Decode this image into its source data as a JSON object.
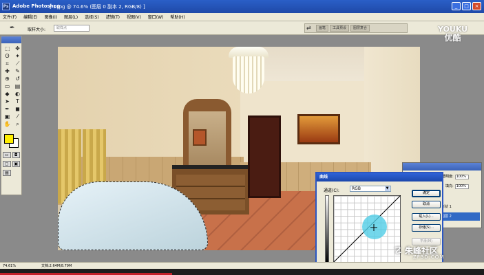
{
  "title_bar": {
    "app_title": "Adobe Photoshop",
    "document_title": "[ 1.jpg @ 74.6% (图层 0 副本 2, RGB/8) ]",
    "ps_icon": "Ps",
    "minimize": "_",
    "maximize": "□",
    "close": "×"
  },
  "menu": {
    "items": [
      "文件(F)",
      "编辑(E)",
      "图像(I)",
      "图层(L)",
      "选择(S)",
      "滤镜(T)",
      "视图(V)",
      "窗口(W)",
      "帮助(H)"
    ]
  },
  "options_bar": {
    "tool_icon": "eyedropper-icon",
    "tool_glyph": "✒",
    "sample_size_label": "取样大小:",
    "sample_size_value": "取样点",
    "palette_well_icon_glyph": "⇄",
    "palette_well_tabs": [
      "画笔",
      "工具预设",
      "图层复合"
    ]
  },
  "watermark_top": {
    "line1": "YOUKU",
    "line2": "优酷"
  },
  "watermark_bottom": {
    "main": "朱峰社区",
    "sub": "ZF3D.COM",
    "icon_glyph": "☡"
  },
  "status_bar": {
    "zoom": "74.61%",
    "doc_info": "文档:2.64M/8.79M",
    "progress": 0
  },
  "layers_panel": {
    "opacity_label": "不透明度:",
    "opacity_value": "100%",
    "fill_label": "填充:",
    "fill_value": "100%",
    "layers": [
      "形状 1",
      "图层 2"
    ],
    "selected_index": 1
  },
  "curves_dialog": {
    "title": "曲线",
    "channel_label": "通道(C):",
    "channel_value": "RGB",
    "buttons": {
      "ok": "确定",
      "cancel": "取消",
      "load": "载入(L)...",
      "save": "存储(S)...",
      "smooth": "平滑(M)"
    }
  },
  "colors": {
    "foreground": "#ffee00",
    "background": "#ffffff",
    "title_bar": "#2a5fc7",
    "highlight": "#50cde6"
  },
  "toolbox": {
    "tools": [
      {
        "name": "marquee-icon",
        "glyph": "⬚"
      },
      {
        "name": "move-icon",
        "glyph": "✥"
      },
      {
        "name": "lasso-icon",
        "glyph": "ʘ"
      },
      {
        "name": "magic-wand-icon",
        "glyph": "✦"
      },
      {
        "name": "crop-icon",
        "glyph": "⌗"
      },
      {
        "name": "slice-icon",
        "glyph": "⟋"
      },
      {
        "name": "healing-brush-icon",
        "glyph": "✚"
      },
      {
        "name": "brush-icon",
        "glyph": "✎"
      },
      {
        "name": "clone-stamp-icon",
        "glyph": "⊕"
      },
      {
        "name": "history-brush-icon",
        "glyph": "↺"
      },
      {
        "name": "eraser-icon",
        "glyph": "▭"
      },
      {
        "name": "gradient-icon",
        "glyph": "▤"
      },
      {
        "name": "blur-icon",
        "glyph": "◆"
      },
      {
        "name": "dodge-icon",
        "glyph": "◐"
      },
      {
        "name": "path-selection-icon",
        "glyph": "➤"
      },
      {
        "name": "type-icon",
        "glyph": "T"
      },
      {
        "name": "pen-icon",
        "glyph": "✒"
      },
      {
        "name": "shape-icon",
        "glyph": "◼"
      },
      {
        "name": "notes-icon",
        "glyph": "▣"
      },
      {
        "name": "eyedropper-icon",
        "glyph": "⁄"
      },
      {
        "name": "hand-icon",
        "glyph": "✋"
      },
      {
        "name": "zoom-icon",
        "glyph": "⌕"
      }
    ],
    "mode_buttons": [
      "▭",
      "◘"
    ],
    "screen_buttons": [
      "▢",
      "▣",
      "▤"
    ]
  }
}
